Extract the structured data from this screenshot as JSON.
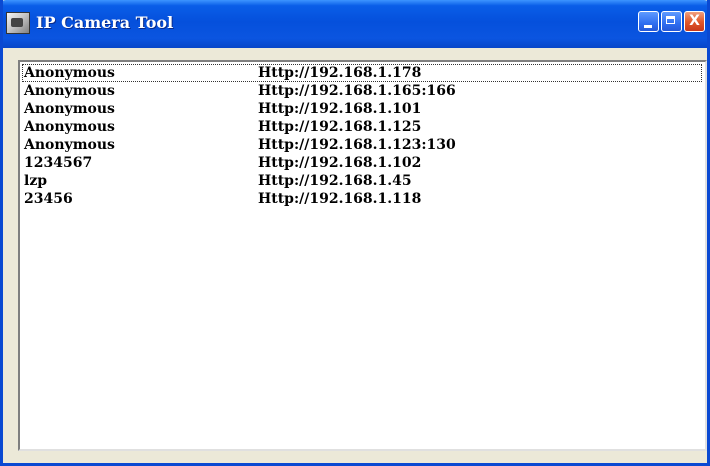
{
  "window": {
    "title": "IP Camera Tool"
  },
  "titlebar_buttons": {
    "close_glyph": "X"
  },
  "cameras": [
    {
      "user": "Anonymous",
      "url": "Http://192.168.1.178"
    },
    {
      "user": "Anonymous",
      "url": "Http://192.168.1.165:166"
    },
    {
      "user": "Anonymous",
      "url": "Http://192.168.1.101"
    },
    {
      "user": "Anonymous",
      "url": "Http://192.168.1.125"
    },
    {
      "user": "Anonymous",
      "url": "Http://192.168.1.123:130"
    },
    {
      "user": "1234567",
      "url": "Http://192.168.1.102"
    },
    {
      "user": "lzp",
      "url": "Http://192.168.1.45"
    },
    {
      "user": "23456",
      "url": "Http://192.168.1.118"
    }
  ],
  "icons": {
    "app": "camera-app-icon",
    "minimize": "minimize-icon",
    "maximize": "maximize-icon",
    "close": "close-icon"
  },
  "colors": {
    "titlebar": "#0550dc",
    "frame": "#0a49d2",
    "close_button": "#e25a2c",
    "list_background": "#ffffff"
  }
}
